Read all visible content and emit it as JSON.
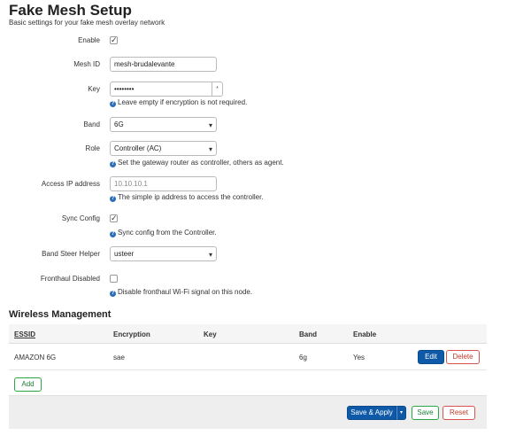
{
  "page": {
    "title": "Fake Mesh Setup",
    "description": "Basic settings for your fake mesh overlay network"
  },
  "form": {
    "enable": {
      "label": "Enable",
      "checked": true,
      "tick": "✓"
    },
    "mesh_id": {
      "label": "Mesh ID",
      "value": "mesh-brudalevante"
    },
    "key": {
      "label": "Key",
      "value": "••••••••",
      "reveal": "*",
      "help": "Leave empty if encryption is not required."
    },
    "band": {
      "label": "Band",
      "value": "6G",
      "caret": "▾"
    },
    "role": {
      "label": "Role",
      "value": "Controller (AC)",
      "caret": "▾",
      "help": "Set the gateway router as controller, others as agent."
    },
    "access_ip": {
      "label": "Access IP address",
      "placeholder": "10.10.10.1",
      "help": "The simple ip address to access the controller."
    },
    "sync_config": {
      "label": "Sync Config",
      "checked": true,
      "tick": "✓",
      "help": "Sync config from the Controller."
    },
    "band_steer": {
      "label": "Band Steer Helper",
      "value": "usteer",
      "caret": "▾"
    },
    "fronthaul": {
      "label": "Fronthaul Disabled",
      "checked": false,
      "help": "Disable fronthaul Wi-Fi signal on this node."
    },
    "help_icon": "?"
  },
  "wireless": {
    "title": "Wireless Management",
    "columns": [
      "ESSID",
      "Encryption",
      "Key",
      "Band",
      "Enable"
    ],
    "rows": [
      {
        "essid": "AMAZON 6G",
        "encryption": "sae",
        "key": "",
        "band": "6g",
        "enable": "Yes",
        "edit_label": "Edit",
        "delete_label": "Delete"
      }
    ],
    "add_label": "Add"
  },
  "footer": {
    "save_apply_label": "Save & Apply",
    "dropdown_caret": "▾",
    "save_label": "Save",
    "reset_label": "Reset"
  },
  "colors": {
    "primary": "#0f5aa8",
    "success": "#28a745",
    "danger": "#d9534f"
  }
}
